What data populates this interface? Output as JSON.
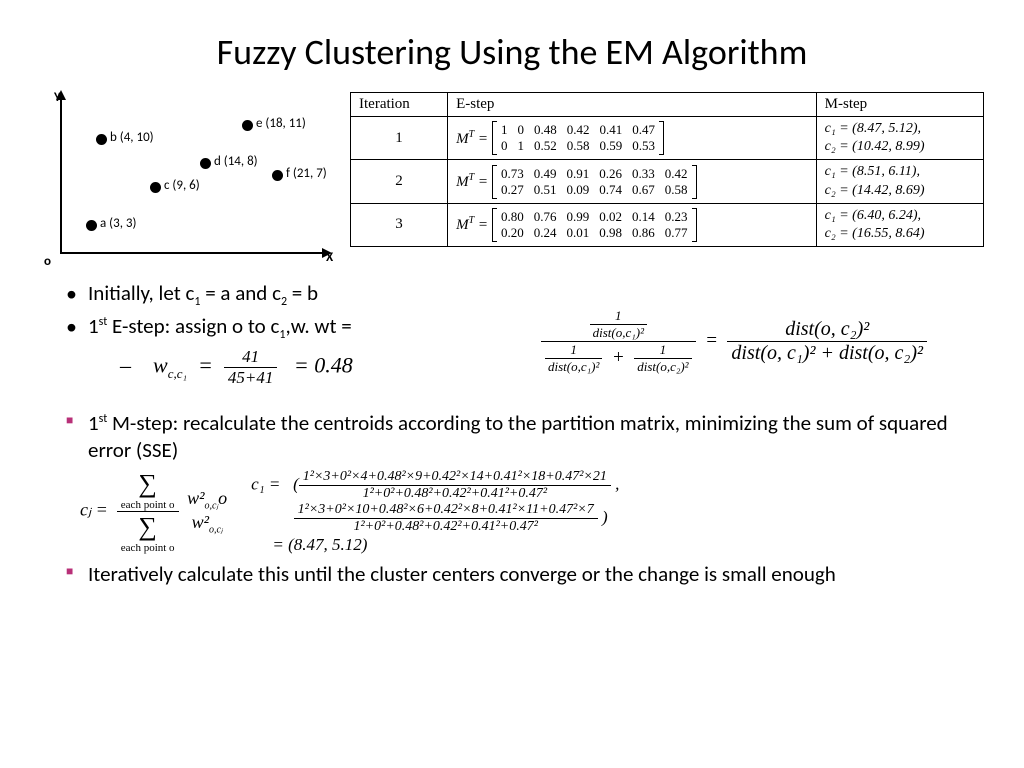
{
  "title": "Fuzzy Clustering Using the EM Algorithm",
  "axes": {
    "y": "Y",
    "x": "X",
    "origin": "o"
  },
  "points": {
    "a": "a (3, 3)",
    "b": "b (4, 10)",
    "c": "c (9, 6)",
    "d": "d (14, 8)",
    "e": "e (18, 11)",
    "f": "f (21, 7)"
  },
  "table": {
    "headers": {
      "iter": "Iteration",
      "e": "E-step",
      "m": "M-step"
    },
    "mt_label_html": "M<sup>T</sup> =",
    "rows": [
      {
        "iter": "1",
        "mat": [
          "1",
          "0",
          "0.48",
          "0.42",
          "0.41",
          "0.47",
          "0",
          "1",
          "0.52",
          "0.58",
          "0.59",
          "0.53"
        ],
        "c1": "c₁ = (8.47, 5.12),",
        "c2": "c₂ = (10.42, 8.99)"
      },
      {
        "iter": "2",
        "mat": [
          "0.73",
          "0.49",
          "0.91",
          "0.26",
          "0.33",
          "0.42",
          "0.27",
          "0.51",
          "0.09",
          "0.74",
          "0.67",
          "0.58"
        ],
        "c1": "c₁ = (8.51, 6.11),",
        "c2": "c₂ = (14.42, 8.69)"
      },
      {
        "iter": "3",
        "mat": [
          "0.80",
          "0.76",
          "0.99",
          "0.02",
          "0.14",
          "0.23",
          "0.20",
          "0.24",
          "0.01",
          "0.98",
          "0.86",
          "0.77"
        ],
        "c1": "c₁ = (6.40, 6.24),",
        "c2": "c₂ = (16.55, 8.64)"
      }
    ]
  },
  "bullets": {
    "b1_html": "Initially, let c<span class=\"sub1\">1</span> = a and c<span class=\"sub1\">2</span> = b",
    "b2_html": "1<span class=\"sup1\">st</span> E-step: assign o to c<span class=\"sub1\">1</span>,w. wt =",
    "b3_html": "1<span class=\"sup1\">st</span> M-step:  recalculate the centroids according to the partition matrix, minimizing the sum of squared error (SSE)",
    "b4": "Iteratively calculate this until the cluster centers converge or the change is small enough"
  },
  "eq_w": {
    "lhs": "w",
    "sub": "c,c₁",
    "mid_num": "41",
    "mid_den": "45+41",
    "rhs": "= 0.48"
  },
  "eq_side": {
    "top_num": "1",
    "top_den": "dist(o,c₁)²",
    "bot_left_num": "1",
    "bot_left_den": "dist(o,c₁)²",
    "bot_right_num": "1",
    "bot_right_den": "dist(o,c₂)²",
    "eq": "=",
    "right_num": "dist(o, c₂)²",
    "right_den": "dist(o, c₁)² + dist(o, c₂)²"
  },
  "eq_cj": {
    "lhs": "cⱼ =",
    "sum": "∑",
    "each": "each point o",
    "wsq": "w²",
    "wsub": "o,cⱼ",
    "o": "o"
  },
  "eq_c1": {
    "label": "c₁ =",
    "line1_num": "1²×3+0²×4+0.48²×9+0.42²×14+0.41²×18+0.47²×21",
    "line1_den": "1²+0²+0.48²+0.42²+0.41²+0.47²",
    "line2_num": "1²×3+0²×10+0.48²×6+0.42²×8+0.41²×11+0.47²×7",
    "line2_den": "1²+0²+0.48²+0.42²+0.41²+0.47²",
    "result": "= (8.47, 5.12)"
  },
  "chart_data": {
    "type": "scatter",
    "title": "",
    "xlabel": "X",
    "ylabel": "Y",
    "xlim": [
      0,
      24
    ],
    "ylim": [
      0,
      13
    ],
    "x": [
      3,
      4,
      9,
      14,
      18,
      21
    ],
    "y": [
      3,
      10,
      6,
      8,
      11,
      7
    ],
    "labels": [
      "a",
      "b",
      "c",
      "d",
      "e",
      "f"
    ]
  }
}
